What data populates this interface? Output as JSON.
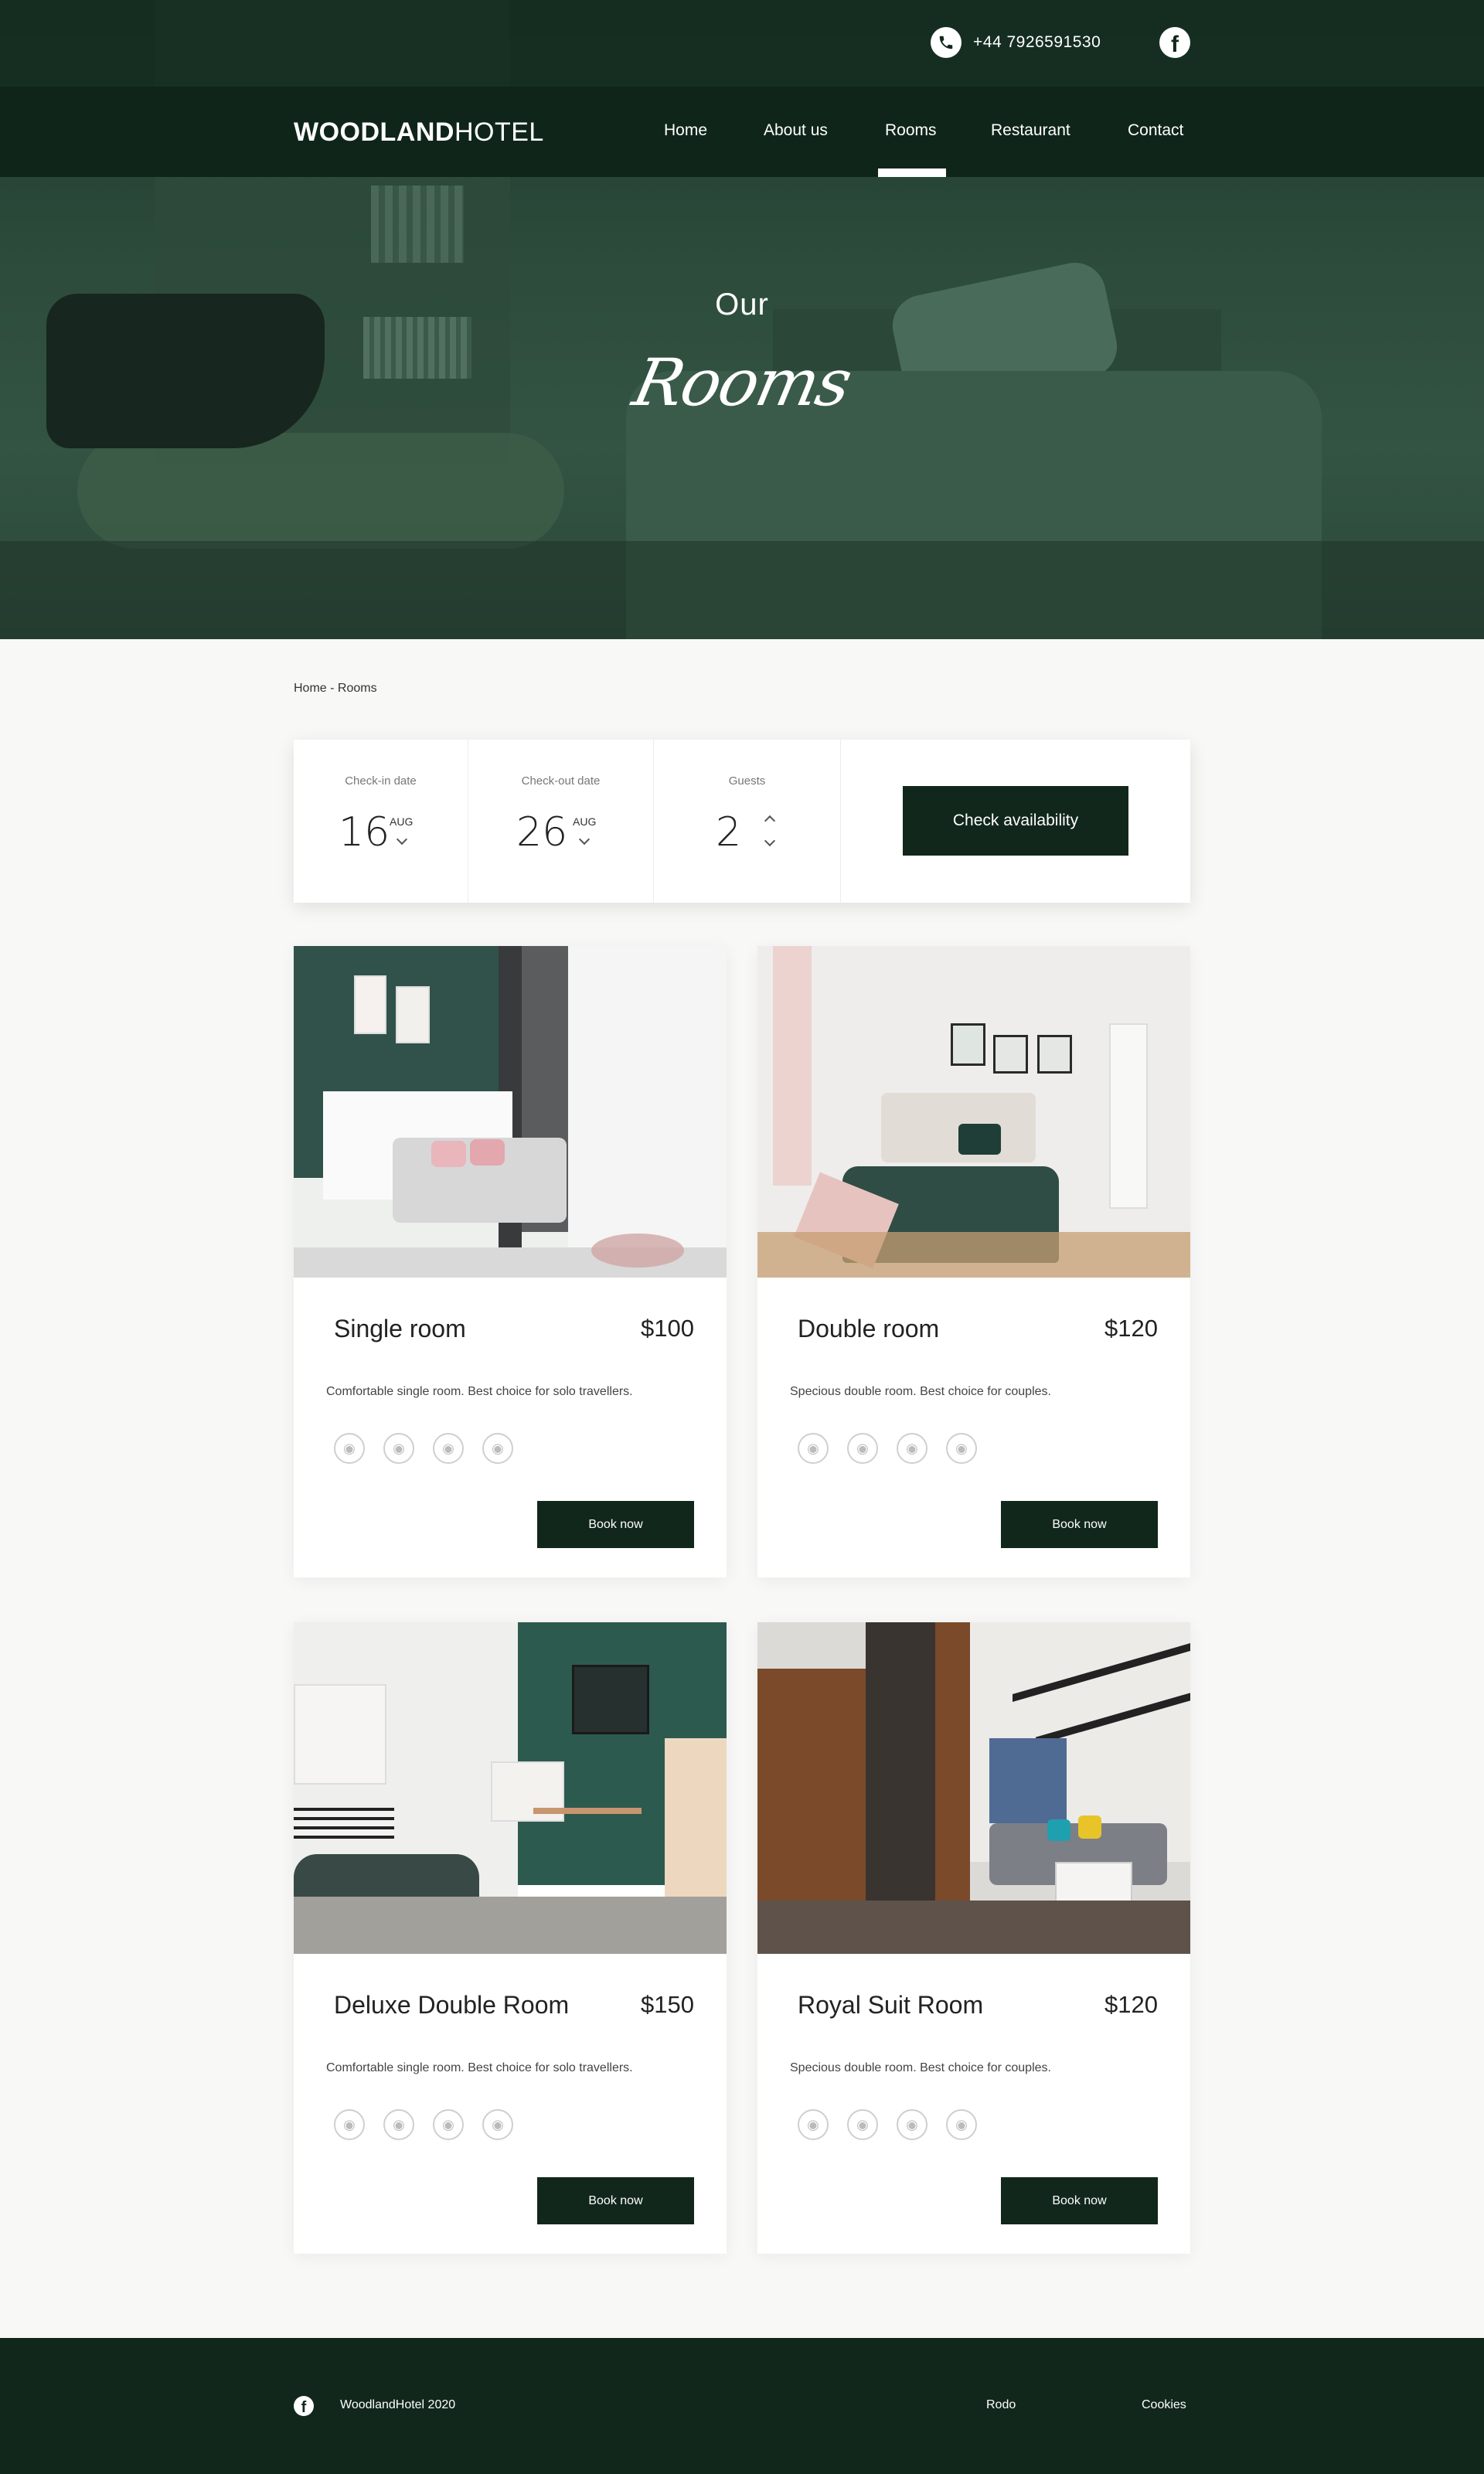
{
  "header": {
    "phone": "+44 7926591530",
    "logo_bold": "WOODLAND",
    "logo_light": "HOTEL",
    "nav": [
      "Home",
      "About us",
      "Rooms",
      "Restaurant",
      "Contact"
    ],
    "active_nav": "Rooms"
  },
  "hero": {
    "line1": "Our",
    "line2": "Rooms"
  },
  "breadcrumb": "Home - Rooms",
  "booking": {
    "checkin_label": "Check-in date",
    "checkin_day": "16",
    "checkin_month": "AUG",
    "checkout_label": "Check-out date",
    "checkout_day": "26",
    "checkout_month": "AUG",
    "guests_label": "Guests",
    "guests": "2",
    "button": "Check availability"
  },
  "rooms": [
    {
      "title": "Single room",
      "price": "$100",
      "desc": "Comfortable single room. Best choice for solo travellers.",
      "button": "Book now"
    },
    {
      "title": "Double room",
      "price": "$120",
      "desc": "Specious double room. Best choice for couples.",
      "button": "Book now"
    },
    {
      "title": "Deluxe Double Room",
      "price": "$150",
      "desc": "Comfortable single room. Best choice for solo travellers.",
      "button": "Book now"
    },
    {
      "title": "Royal Suit Room",
      "price": "$120",
      "desc": "Specious double room. Best choice for couples.",
      "button": "Book now"
    }
  ],
  "footer": {
    "copyright": "WoodlandHotel 2020",
    "links": [
      "Rodo",
      "Cookies"
    ]
  },
  "colors": {
    "brand_dark": "#12271c",
    "hero_green": "#2c4b3b",
    "background": "#f8f8f7"
  },
  "icons": [
    "phone-icon",
    "facebook-icon",
    "chevron-down-icon",
    "chevron-up-icon",
    "amenity-icon"
  ]
}
